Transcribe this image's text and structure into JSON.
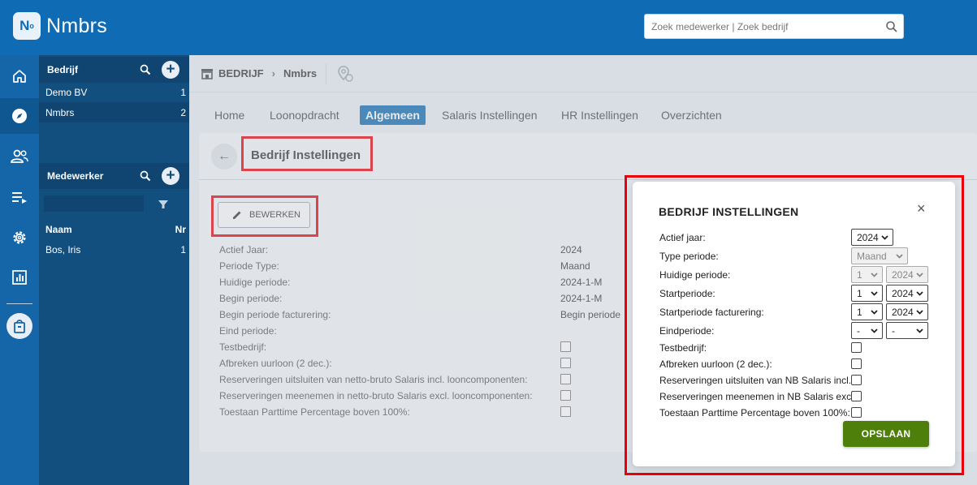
{
  "app": {
    "logo_mark": "N",
    "logo_sup": "o",
    "brand": "Nmbrs"
  },
  "search": {
    "placeholder": "Zoek medewerker | Zoek bedrijf"
  },
  "rail": {
    "icons": [
      "home-icon",
      "compass-icon",
      "users-icon",
      "playlist-icon",
      "gear-icon",
      "report-chart-icon",
      "shopping-bag-icon"
    ]
  },
  "companies": {
    "header": "Bedrijf",
    "items": [
      {
        "name": "Demo BV",
        "nr": "1"
      },
      {
        "name": "Nmbrs",
        "nr": "2"
      }
    ]
  },
  "employees": {
    "header": "Medewerker",
    "col_name": "Naam",
    "col_nr": "Nr",
    "items": [
      {
        "name": "Bos, Iris",
        "nr": "1"
      }
    ]
  },
  "breadcrumb": {
    "root": "BEDRIJF",
    "current": "Nmbrs"
  },
  "tabs": [
    "Home",
    "Loonopdracht",
    "Algemeen",
    "Salaris Instellingen",
    "HR Instellingen",
    "Overzichten"
  ],
  "card": {
    "title": "Bedrijf Instellingen",
    "edit_label": "BEWERKEN",
    "fields": [
      {
        "label": "Actief Jaar:",
        "value": "2024"
      },
      {
        "label": "Periode Type:",
        "value": "Maand"
      },
      {
        "label": "Huidige periode:",
        "value": "2024-1-M"
      },
      {
        "label": "Begin periode:",
        "value": "2024-1-M"
      },
      {
        "label": "Begin periode facturering:",
        "value": "Begin periode"
      },
      {
        "label": "Eind periode:",
        "value": ""
      },
      {
        "label": "Testbedrijf:",
        "value": ""
      },
      {
        "label": "Afbreken uurloon (2 dec.):",
        "value": ""
      },
      {
        "label": "Reserveringen uitsluiten van netto-bruto Salaris incl. looncomponenten:",
        "value": ""
      },
      {
        "label": "Reserveringen meenemen in netto-bruto Salaris excl. looncomponenten:",
        "value": ""
      },
      {
        "label": "Toestaan Parttime Percentage boven 100%:",
        "value": ""
      }
    ]
  },
  "modal": {
    "title": "BEDRIJF INSTELLINGEN",
    "close": "×",
    "actief_jaar": {
      "label": "Actief jaar:",
      "value": "2024"
    },
    "type_periode": {
      "label": "Type periode:",
      "value": "Maand"
    },
    "huidige_periode": {
      "label": "Huidige periode:",
      "period": "1",
      "year": "2024"
    },
    "startperiode": {
      "label": "Startperiode:",
      "period": "1",
      "year": "2024"
    },
    "startperiode_facturering": {
      "label": "Startperiode facturering:",
      "period": "1",
      "year": "2024"
    },
    "eindperiode": {
      "label": "Eindperiode:",
      "period": "-",
      "year": "-"
    },
    "checkboxes": [
      "Testbedrijf:",
      "Afbreken uurloon (2 dec.):",
      "Reserveringen uitsluiten van NB Salaris incl.:",
      "Reserveringen meenemen in NB Salaris excl.:",
      "Toestaan Parttime Percentage boven 100%:"
    ],
    "save_label": "OPSLAAN"
  },
  "colors": {
    "brand": "#0f6bb3",
    "panel": "#134f7e",
    "save": "#4e7f0a",
    "highlight": "#e8000a"
  }
}
